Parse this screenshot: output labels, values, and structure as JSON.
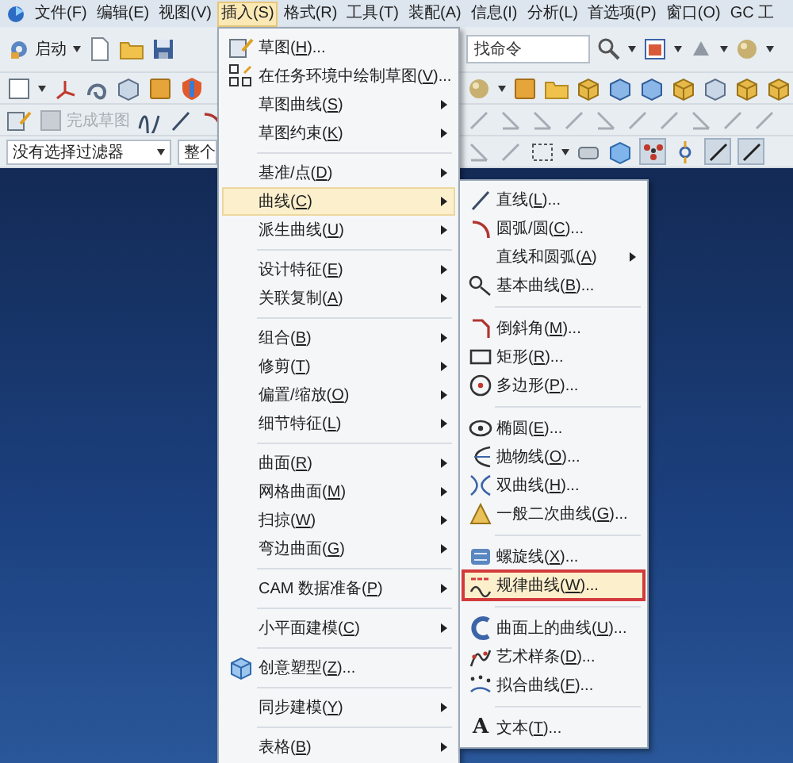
{
  "menubar": [
    {
      "label": "文件(F)",
      "selected": false
    },
    {
      "label": "编辑(E)",
      "selected": false
    },
    {
      "label": "视图(V)",
      "selected": false
    },
    {
      "label": "插入(S)",
      "selected": true
    },
    {
      "label": "格式(R)",
      "selected": false
    },
    {
      "label": "工具(T)",
      "selected": false
    },
    {
      "label": "装配(A)",
      "selected": false
    },
    {
      "label": "信息(I)",
      "selected": false
    },
    {
      "label": "分析(L)",
      "selected": false
    },
    {
      "label": "首选项(P)",
      "selected": false
    },
    {
      "label": "窗口(O)",
      "selected": false
    },
    {
      "label": "GC 工",
      "selected": false
    }
  ],
  "toolbar": {
    "start_button": "启动",
    "search": {
      "placeholder": "找命令"
    },
    "finish_sketch": {
      "label": "完成草图",
      "disabled": true
    },
    "filters": [
      {
        "value": "没有选择过滤器"
      },
      {
        "value": "整个"
      }
    ]
  },
  "insert_menu": {
    "groups": [
      [
        {
          "label": "草图(H)...",
          "submenu": false,
          "selected": false
        },
        {
          "label": "在任务环境中绘制草图(V)...",
          "submenu": false,
          "selected": false
        },
        {
          "label": "草图曲线(S)",
          "submenu": true,
          "selected": false
        },
        {
          "label": "草图约束(K)",
          "submenu": true,
          "selected": false
        }
      ],
      [
        {
          "label": "基准/点(D)",
          "submenu": true,
          "selected": false
        },
        {
          "label": "曲线(C)",
          "submenu": true,
          "selected": true
        },
        {
          "label": "派生曲线(U)",
          "submenu": true,
          "selected": false
        }
      ],
      [
        {
          "label": "设计特征(E)",
          "submenu": true,
          "selected": false
        },
        {
          "label": "关联复制(A)",
          "submenu": true,
          "selected": false
        }
      ],
      [
        {
          "label": "组合(B)",
          "submenu": true,
          "selected": false
        },
        {
          "label": "修剪(T)",
          "submenu": true,
          "selected": false
        },
        {
          "label": "偏置/缩放(O)",
          "submenu": true,
          "selected": false
        },
        {
          "label": "细节特征(L)",
          "submenu": true,
          "selected": false
        }
      ],
      [
        {
          "label": "曲面(R)",
          "submenu": true,
          "selected": false
        },
        {
          "label": "网格曲面(M)",
          "submenu": true,
          "selected": false
        },
        {
          "label": "扫掠(W)",
          "submenu": true,
          "selected": false
        },
        {
          "label": "弯边曲面(G)",
          "submenu": true,
          "selected": false
        }
      ],
      [
        {
          "label": "CAM 数据准备(P)",
          "submenu": true,
          "selected": false
        }
      ],
      [
        {
          "label": "小平面建模(C)",
          "submenu": true,
          "selected": false
        }
      ],
      [
        {
          "label": "创意塑型(Z)...",
          "submenu": false,
          "selected": false
        }
      ],
      [
        {
          "label": "同步建模(Y)",
          "submenu": true,
          "selected": false
        }
      ],
      [
        {
          "label": "表格(B)",
          "submenu": true,
          "selected": false
        }
      ]
    ]
  },
  "curve_submenu": {
    "groups": [
      [
        {
          "label": "直线(L)...",
          "submenu": false,
          "selected": false,
          "marked": false
        },
        {
          "label": "圆弧/圆(C)...",
          "submenu": false,
          "selected": false,
          "marked": false
        },
        {
          "label": "直线和圆弧(A)",
          "submenu": true,
          "selected": false,
          "marked": false
        },
        {
          "label": "基本曲线(B)...",
          "submenu": false,
          "selected": false,
          "marked": false
        }
      ],
      [
        {
          "label": "倒斜角(M)...",
          "submenu": false,
          "selected": false,
          "marked": false
        },
        {
          "label": "矩形(R)...",
          "submenu": false,
          "selected": false,
          "marked": false
        },
        {
          "label": "多边形(P)...",
          "submenu": false,
          "selected": false,
          "marked": false
        }
      ],
      [
        {
          "label": "椭圆(E)...",
          "submenu": false,
          "selected": false,
          "marked": false
        },
        {
          "label": "抛物线(O)...",
          "submenu": false,
          "selected": false,
          "marked": false
        },
        {
          "label": "双曲线(H)...",
          "submenu": false,
          "selected": false,
          "marked": false
        },
        {
          "label": "一般二次曲线(G)...",
          "submenu": false,
          "selected": false,
          "marked": false
        }
      ],
      [
        {
          "label": "螺旋线(X)...",
          "submenu": false,
          "selected": false,
          "marked": false
        },
        {
          "label": "规律曲线(W)...",
          "submenu": false,
          "selected": true,
          "marked": true
        }
      ],
      [
        {
          "label": "曲面上的曲线(U)...",
          "submenu": false,
          "selected": false,
          "marked": false
        },
        {
          "label": "艺术样条(D)...",
          "submenu": false,
          "selected": false,
          "marked": false
        },
        {
          "label": "拟合曲线(F)...",
          "submenu": false,
          "selected": false,
          "marked": false
        }
      ],
      [
        {
          "label": "文本(T)...",
          "submenu": false,
          "selected": false,
          "marked": false,
          "glyph": "A"
        }
      ]
    ]
  }
}
